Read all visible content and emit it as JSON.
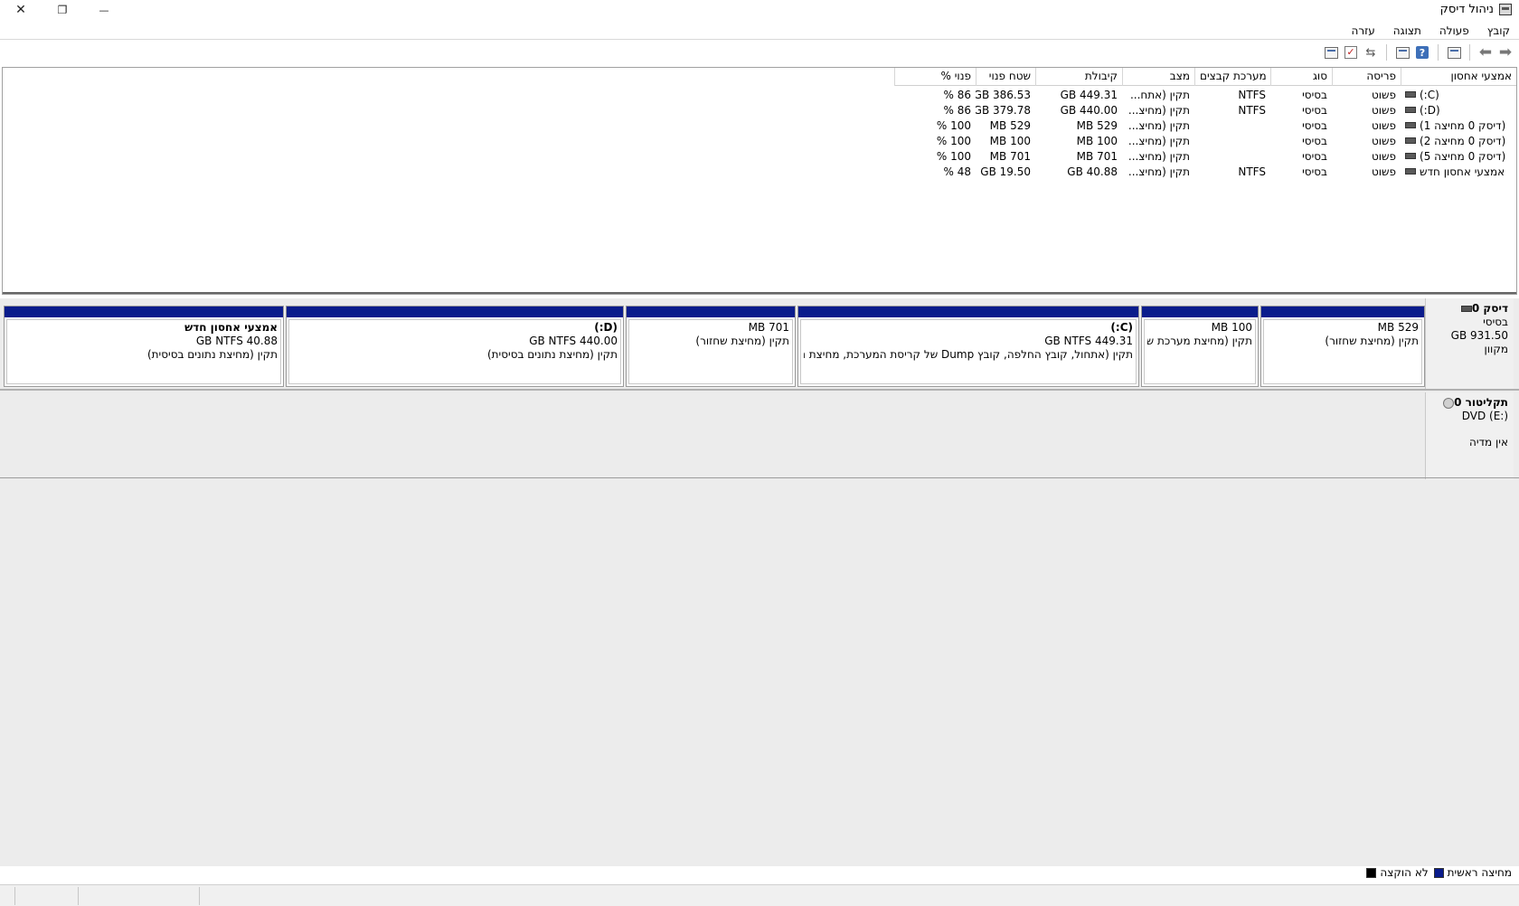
{
  "window": {
    "title": "ניהול דיסק",
    "close_glyph": "✕",
    "restore_glyph": "❐",
    "minimize_glyph": "—"
  },
  "menu": {
    "items": [
      "קובץ",
      "פעולה",
      "תצוגה",
      "עזרה"
    ]
  },
  "toolbar": {
    "icons": [
      "forward-arrow-icon",
      "back-arrow-icon",
      "properties-icon",
      "help-icon",
      "show-hide-icon",
      "refresh-icon",
      "check-icon",
      "rescan-icon"
    ]
  },
  "volume_list": {
    "columns": [
      "אמצעי אחסון",
      "פריסה",
      "סוג",
      "מערכת קבצים",
      "מצב",
      "קיבולת",
      "שטח פנוי",
      "% פנוי"
    ],
    "rows": [
      [
        "(C:)",
        "פשוט",
        "בסיסי",
        "NTFS",
        "תקין (אתח...",
        "449.31 GB",
        "386.53 GB",
        "86 %"
      ],
      [
        "(D:)",
        "פשוט",
        "בסיסי",
        "NTFS",
        "תקין (מחיצ...",
        "440.00 GB",
        "379.78 GB",
        "86 %"
      ],
      [
        "(דיסק 0 מחיצה 1)",
        "פשוט",
        "בסיסי",
        "",
        "תקין (מחיצ...",
        "529 MB",
        "529 MB",
        "100 %"
      ],
      [
        "(דיסק 0 מחיצה 2)",
        "פשוט",
        "בסיסי",
        "",
        "תקין (מחיצ...",
        "100 MB",
        "100 MB",
        "100 %"
      ],
      [
        "(דיסק 0 מחיצה 5)",
        "פשוט",
        "בסיסי",
        "",
        "תקין (מחיצ...",
        "701 MB",
        "701 MB",
        "100 %"
      ],
      [
        "אמצעי אחסון חדש",
        "פשוט",
        "בסיסי",
        "NTFS",
        "תקין (מחיצ...",
        "40.88 GB",
        "19.50 GB",
        "48 %"
      ]
    ]
  },
  "disk0": {
    "name": "דיסק 0",
    "type": "בסיסי",
    "size": "931.50 GB",
    "status": "מקוון",
    "partitions": [
      {
        "name": "",
        "size": "529 MB",
        "status": "תקין (מחיצת שחזור)"
      },
      {
        "name": "",
        "size": "100 MB",
        "status": "תקין (מחיצת מערכת ש"
      },
      {
        "name": "(C:)",
        "size": "449.31 GB NTFS",
        "status": "תקין (אתחול, קובץ החלפה, קובץ Dump של קריסת המערכת, מחיצת נ"
      },
      {
        "name": "",
        "size": "701 MB",
        "status": "תקין (מחיצת שחזור)"
      },
      {
        "name": "(D:)",
        "size": "440.00 GB NTFS",
        "status": "תקין (מחיצת נתונים בסיסית)"
      },
      {
        "name": "אמצעי אחסון חדש",
        "size": "40.88 GB NTFS",
        "status": "תקין (מחיצת נתונים בסיסית)"
      }
    ]
  },
  "cdrom0": {
    "name": "תקליטור 0",
    "type": "DVD (E:)",
    "status": "אין מדיה"
  },
  "legend": {
    "unallocated": "לא הוקצה",
    "primary": "מחיצה ראשית",
    "unallocated_color": "#000000",
    "primary_color": "#0a1c8c"
  }
}
